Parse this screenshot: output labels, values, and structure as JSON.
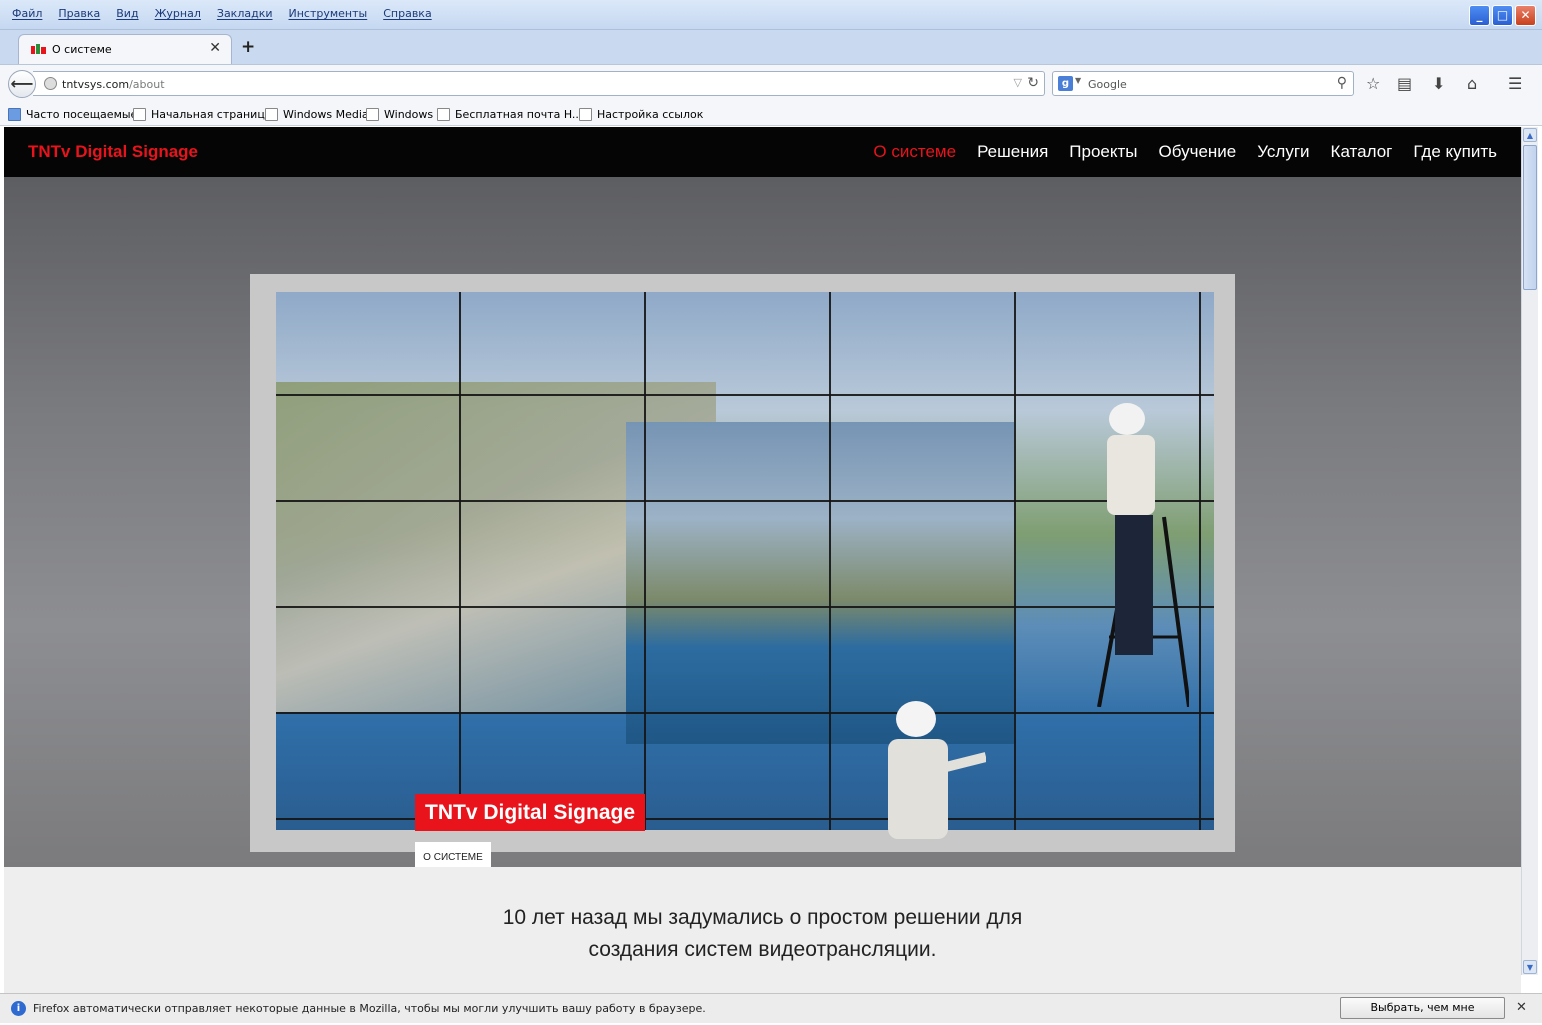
{
  "window": {
    "menu": [
      "Файл",
      "Правка",
      "Вид",
      "Журнал",
      "Закладки",
      "Инструменты",
      "Справка"
    ],
    "controls": {
      "minimize": "_",
      "maximize": "□",
      "close": "✕"
    }
  },
  "tab": {
    "title": "О системе",
    "close": "✕",
    "new_tab": "+"
  },
  "address": {
    "host": "tntvsys.com",
    "path": "/about"
  },
  "search": {
    "engine_letter": "g",
    "placeholder": "Google"
  },
  "bookmarks": [
    "Часто посещаемые",
    "Начальная страница",
    "Windows Media",
    "Windows",
    "Бесплатная почта H...",
    "Настройка ссылок"
  ],
  "site": {
    "brand": "TNTv Digital Signage",
    "nav": [
      {
        "label": "О системе",
        "active": true
      },
      {
        "label": "Решения"
      },
      {
        "label": "Проекты"
      },
      {
        "label": "Обучение"
      },
      {
        "label": "Услуги"
      },
      {
        "label": "Каталог"
      },
      {
        "label": "Где купить"
      }
    ],
    "hero_title": "TNTv Digital Signage",
    "hero_button": "О СИСТЕМЕ",
    "intro_line1": "10 лет назад мы задумались о простом решении для",
    "intro_line2": "создания систем видеотрансляции."
  },
  "notification": {
    "icon": "i",
    "text": "Firefox автоматически отправляет некоторые данные в Mozilla, чтобы мы могли улучшить вашу работу в браузере.",
    "button": "Выбрать, чем мне поделиться",
    "close": "✕"
  },
  "colors": {
    "accent": "#e8131b",
    "nav_bg": "#050505",
    "page_bg": "#eeeeee"
  }
}
